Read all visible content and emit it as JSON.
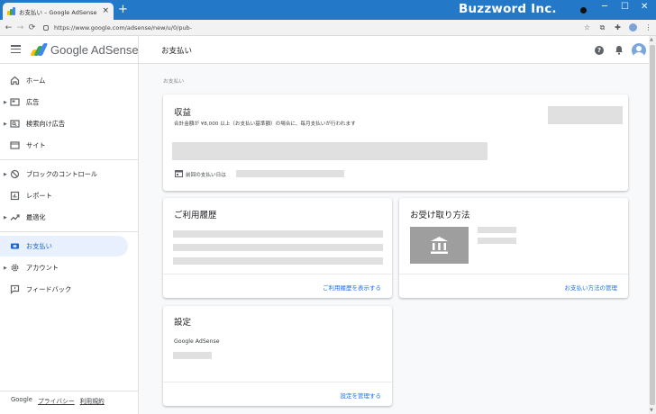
{
  "browser": {
    "tab_title": "お支払い – Google AdSense",
    "tab_close": "×",
    "new_tab": "+",
    "url": "https://www.google.com/adsense/new/u/0/pub-",
    "brand_watermark": "Buzzword Inc.",
    "window_controls": {
      "minimize": "─",
      "maximize": "☐",
      "close": "✕"
    },
    "nav": {
      "back": "←",
      "forward": "→",
      "reload": "⟳"
    },
    "toolbar_icons": [
      "star-icon",
      "extension-icon",
      "puzzle-icon",
      "profile-icon",
      "menu-icon"
    ]
  },
  "app": {
    "name": "Google AdSense",
    "page_title": "お支払い",
    "colors": {
      "accent": "#1a73e8",
      "active_bg": "#e8f0fe",
      "placeholder": "#e0e0e0"
    }
  },
  "sidebar": {
    "items": [
      {
        "label": "ホーム",
        "icon": "home-icon"
      },
      {
        "label": "広告",
        "icon": "ads-icon"
      },
      {
        "label": "検索向け広告",
        "icon": "search-ads-icon"
      },
      {
        "label": "サイト",
        "icon": "sites-icon"
      },
      {
        "label": "ブロックのコントロール",
        "icon": "block-icon"
      },
      {
        "label": "レポート",
        "icon": "reports-icon"
      },
      {
        "label": "最適化",
        "icon": "trending-icon"
      },
      {
        "label": "お支払い",
        "icon": "payments-icon"
      },
      {
        "label": "アカウント",
        "icon": "gear-icon"
      },
      {
        "label": "フィードバック",
        "icon": "feedback-icon"
      }
    ],
    "footer": {
      "brand": "Google",
      "privacy": "プライバシー",
      "terms": "利用規約"
    }
  },
  "main": {
    "breadcrumb": "お支払い",
    "earnings": {
      "title": "収益",
      "subtitle": "合計金額が ¥8,000 以上（お支払い基準額）の場合に、毎月支払いが行われます",
      "last_payment_label": "前回の支払い日は"
    },
    "transactions": {
      "title": "ご利用履歴",
      "link": "ご利用履歴を表示する"
    },
    "payment_method": {
      "title": "お受け取り方法",
      "link": "お支払い方法の管理"
    },
    "settings": {
      "title": "設定",
      "product": "Google AdSense",
      "link": "設定を管理する"
    }
  }
}
